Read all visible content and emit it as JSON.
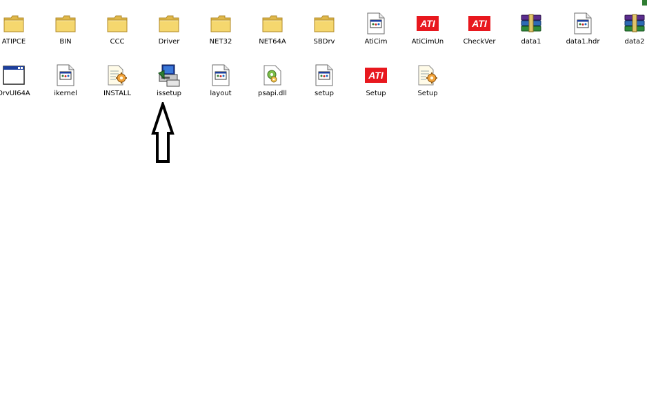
{
  "window": {
    "view": "Icons"
  },
  "files": [
    {
      "id": "atipce",
      "name": "ATIPCE",
      "icon": "folder-icon"
    },
    {
      "id": "bin",
      "name": "BIN",
      "icon": "folder-icon"
    },
    {
      "id": "ccc",
      "name": "CCC",
      "icon": "folder-icon"
    },
    {
      "id": "driver",
      "name": "Driver",
      "icon": "folder-icon"
    },
    {
      "id": "net32",
      "name": "NET32",
      "icon": "folder-icon"
    },
    {
      "id": "net64a",
      "name": "NET64A",
      "icon": "folder-icon"
    },
    {
      "id": "sbdrv",
      "name": "SBDrv",
      "icon": "folder-icon"
    },
    {
      "id": "aticim",
      "name": "AtiCim",
      "icon": "application-icon"
    },
    {
      "id": "aticimun",
      "name": "AtiCimUn",
      "icon": "ati-logo-icon"
    },
    {
      "id": "checkver",
      "name": "CheckVer",
      "icon": "ati-logo-icon"
    },
    {
      "id": "data1",
      "name": "data1",
      "icon": "winrar-archive-icon"
    },
    {
      "id": "data1-hdr",
      "name": "data1.hdr",
      "icon": "application-icon"
    },
    {
      "id": "data2",
      "name": "data2",
      "icon": "winrar-archive-icon"
    },
    {
      "id": "drvui64a",
      "name": "DrvUI64A",
      "icon": "window-app-icon"
    },
    {
      "id": "ikernel",
      "name": "ikernel",
      "icon": "application-icon"
    },
    {
      "id": "install",
      "name": "INSTALL",
      "icon": "config-settings-icon"
    },
    {
      "id": "issetup",
      "name": "issetup",
      "icon": "installer-icon"
    },
    {
      "id": "layout",
      "name": "layout",
      "icon": "application-icon"
    },
    {
      "id": "psapi-dll",
      "name": "psapi.dll",
      "icon": "dll-gear-icon"
    },
    {
      "id": "setup-1",
      "name": "setup",
      "icon": "application-icon"
    },
    {
      "id": "setup-2",
      "name": "Setup",
      "icon": "ati-logo-icon"
    },
    {
      "id": "setup-3",
      "name": "Setup",
      "icon": "config-settings-icon"
    }
  ],
  "annotation": {
    "icon": "up-arrow-outline-icon",
    "points_to": "issetup"
  },
  "colors": {
    "folder": "#f5d76e",
    "ati_red": "#e8181e",
    "winrar_purple": "#5b2d8e",
    "selection": "#316ac5",
    "corner_mark": "#2f7d32"
  }
}
